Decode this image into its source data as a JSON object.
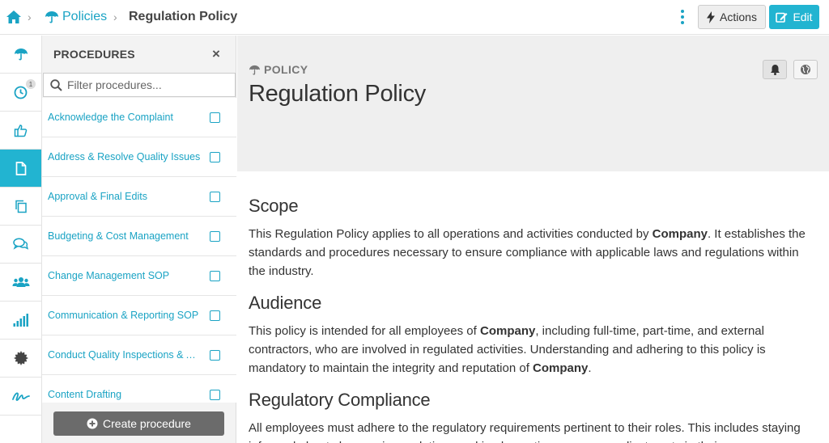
{
  "breadcrumb": {
    "section": "Policies",
    "current": "Regulation Policy"
  },
  "toolbar": {
    "actions_label": "Actions",
    "edit_label": "Edit"
  },
  "rail": {
    "history_badge": "1",
    "items": [
      "umbrella-icon",
      "clock-icon",
      "thumbs-up-icon",
      "document-icon",
      "copy-icon",
      "comments-icon",
      "users-icon",
      "signal-icon",
      "gear-icon",
      "signature-icon"
    ]
  },
  "procedures": {
    "title": "PROCEDURES",
    "close": "×",
    "filter_placeholder": "Filter procedures...",
    "items": [
      "Acknowledge the Complaint",
      "Address & Resolve Quality Issues",
      "Approval & Final Edits",
      "Budgeting & Cost Management",
      "Change Management SOP",
      "Communication & Reporting SOP",
      "Conduct Quality Inspections & Audits",
      "Content Drafting"
    ],
    "create_label": "Create procedure"
  },
  "document": {
    "kicker": "POLICY",
    "title": "Regulation Policy",
    "sections": [
      {
        "heading": "Scope",
        "pre": "This Regulation Policy applies to all operations and activities conducted by ",
        "bold1": "Company",
        "post": ". It establishes the standards and procedures necessary to ensure compliance with applicable laws and regulations within the industry."
      },
      {
        "heading": "Audience",
        "pre": "This policy is intended for all employees of ",
        "bold1": "Company",
        "mid": ", including full-time, part-time, and external contractors, who are involved in regulated activities. Understanding and adhering to this policy is mandatory to maintain the integrity and reputation of ",
        "bold2": "Company",
        "post": "."
      },
      {
        "heading": "Regulatory Compliance",
        "pre": "All employees must adhere to the regulatory requirements pertinent to their roles. This includes staying informed about changes in regulations and implementing necessary adjustments in their"
      }
    ]
  },
  "colors": {
    "accent": "#22b4d1",
    "link": "#1aa3c4",
    "header_bg": "#efefef",
    "panel_bg": "#f3f3f3"
  }
}
